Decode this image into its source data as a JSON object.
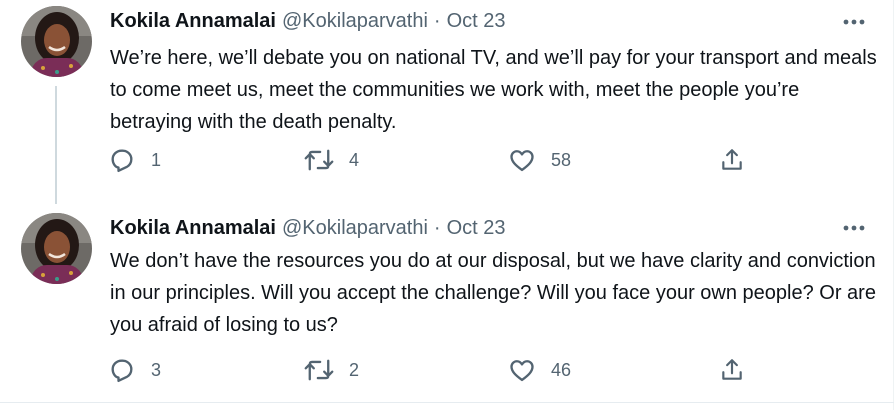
{
  "tweets": [
    {
      "author": "Kokila Annamalai",
      "handle": "@Kokilaparvathi",
      "separator": "·",
      "time": "Oct 23",
      "text": "We’re here, we’ll debate you on national TV, and we’ll pay for your transport and meals to come meet us, meet the communities we work with, meet the people you’re betraying with the death penalty.",
      "replies": "1",
      "retweets": "4",
      "likes": "58"
    },
    {
      "author": "Kokila Annamalai",
      "handle": "@Kokilaparvathi",
      "separator": "·",
      "time": "Oct 23",
      "text": "We don’t have the resources you do at our disposal, but we have clarity and conviction in our principles. Will you accept the challenge? Will you face your own people? Or are you afraid of losing to us?",
      "replies": "3",
      "retweets": "2",
      "likes": "46"
    }
  ],
  "icons": {
    "more": "more-horizontal-icon",
    "reply": "reply-bubble-icon",
    "retweet": "retweet-icon",
    "like": "heart-icon",
    "share": "share-upload-icon"
  },
  "colors": {
    "text": "#0f1419",
    "secondary": "#536471",
    "thread_line": "#cfd9de",
    "border": "#eff3f4"
  }
}
